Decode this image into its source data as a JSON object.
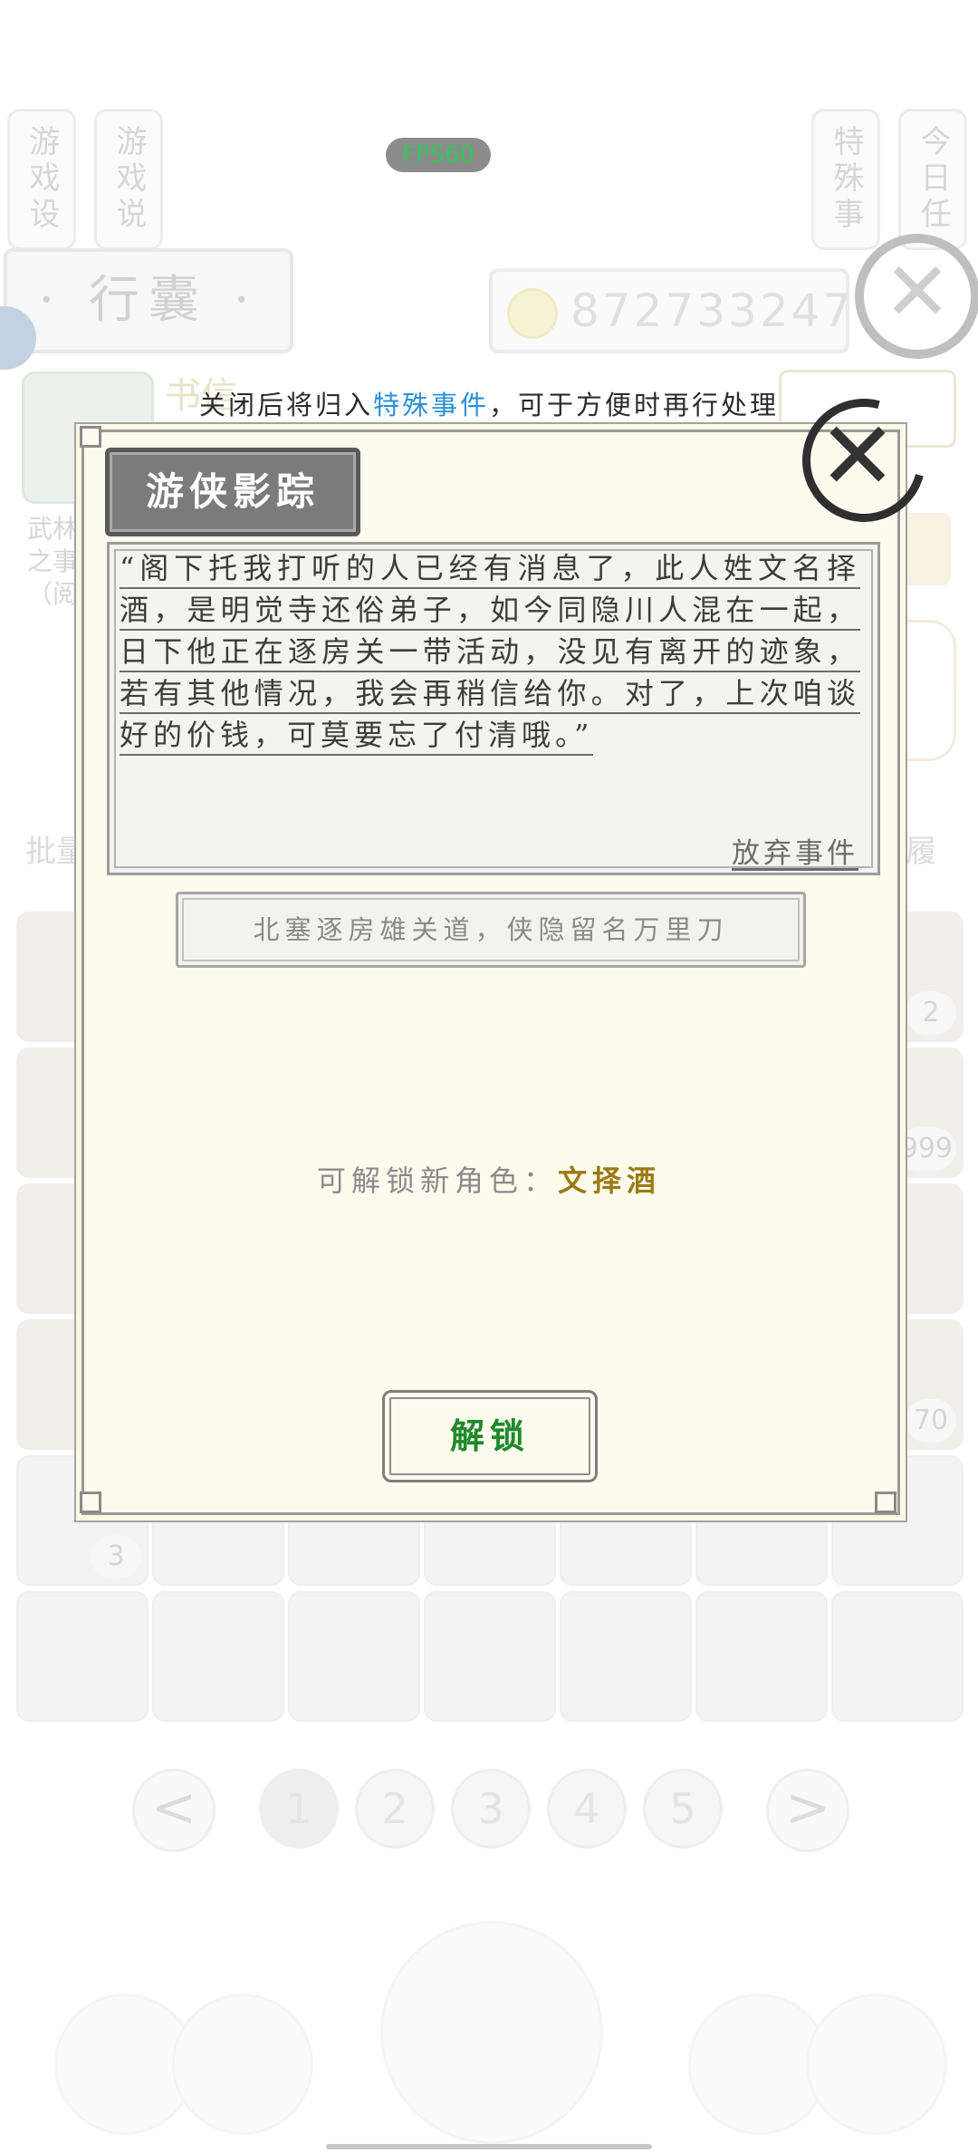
{
  "status": {
    "fps": "FPS60"
  },
  "background": {
    "side_tabs": [
      "游戏设置",
      "游戏说明",
      "特殊事件",
      "今日任务"
    ],
    "bag_title": "· 行囊 ·",
    "coins": "872733247",
    "item_preview": {
      "name": "书信",
      "hint_line1": "武林",
      "hint_line2": "之事",
      "hint_line3": "（阅"
    },
    "toolbar_left": "批量",
    "toolbar_right": "履",
    "cell_badges": [
      "2",
      "999",
      "70",
      "3"
    ],
    "pages": [
      "1",
      "2",
      "3",
      "4",
      "5"
    ],
    "prev_symbol": "<",
    "next_symbol": ">"
  },
  "overlay": {
    "notice_prefix": "关闭后将归入",
    "notice_highlight": "特殊事件",
    "notice_suffix": "，可于方便时再行处理",
    "title": "游侠影踪",
    "close_symbol": "✕",
    "story": "“阁下托我打听的人已经有消息了，此人姓文名择酒，是明觉寺还俗弟子，如今同隐川人混在一起，日下他正在逐房关一带活动，没见有离开的迹象，若有其他情况，我会再稍信给你。对了，上次咱谈好的价钱，可莫要忘了付清哦。”",
    "abandon_label": "放弃事件",
    "subtitle": "北塞逐房雄关道，侠隐留名万里刀",
    "unlock_prefix": "可解锁新角色：",
    "unlock_role": "文择酒",
    "unlock_button": "解锁"
  },
  "colors": {
    "highlight_blue": "#2c8fd6",
    "role_gold": "#9a7b12",
    "unlock_green": "#1f8a2c",
    "fps_green": "#34c759"
  }
}
